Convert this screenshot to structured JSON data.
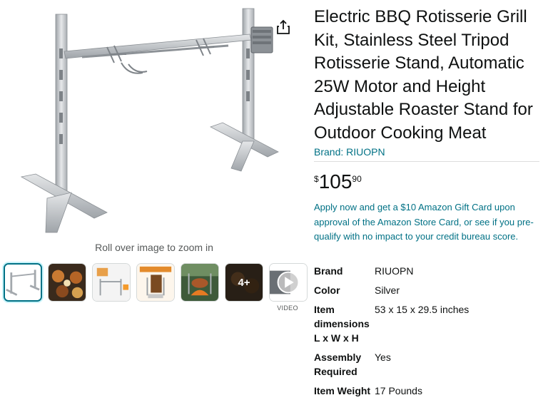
{
  "product": {
    "title": "Electric BBQ Rotisserie Grill Kit, Stainless Steel Tripod Rotisserie Stand, Automatic 25W Motor and Height Adjustable Roaster Stand for Outdoor Cooking Meat",
    "brand_link": "Brand: RIUOPN"
  },
  "gallery": {
    "zoom_hint": "Roll over image to zoom in",
    "more_count": "4+",
    "video_label": "VIDEO",
    "share_icon": "share-icon"
  },
  "price": {
    "symbol": "$",
    "whole": "105",
    "fraction": "90"
  },
  "promo": {
    "text": "Apply now and get a $10 Amazon Gift Card upon approval of the Amazon Store Card, or see if you pre-qualify with no impact to your credit bureau score."
  },
  "specs": [
    {
      "key": "Brand",
      "value": "RIUOPN"
    },
    {
      "key": "Color",
      "value": "Silver"
    },
    {
      "key": "Item dimensions L x W x H",
      "value": "53 x 15 x 29.5 inches"
    },
    {
      "key": "Assembly Required",
      "value": "Yes"
    },
    {
      "key": "Item Weight",
      "value": "17 Pounds"
    }
  ],
  "colors": {
    "link": "#007185",
    "text": "#0f1111",
    "muted": "#565959",
    "active_thumb": "#007185"
  }
}
